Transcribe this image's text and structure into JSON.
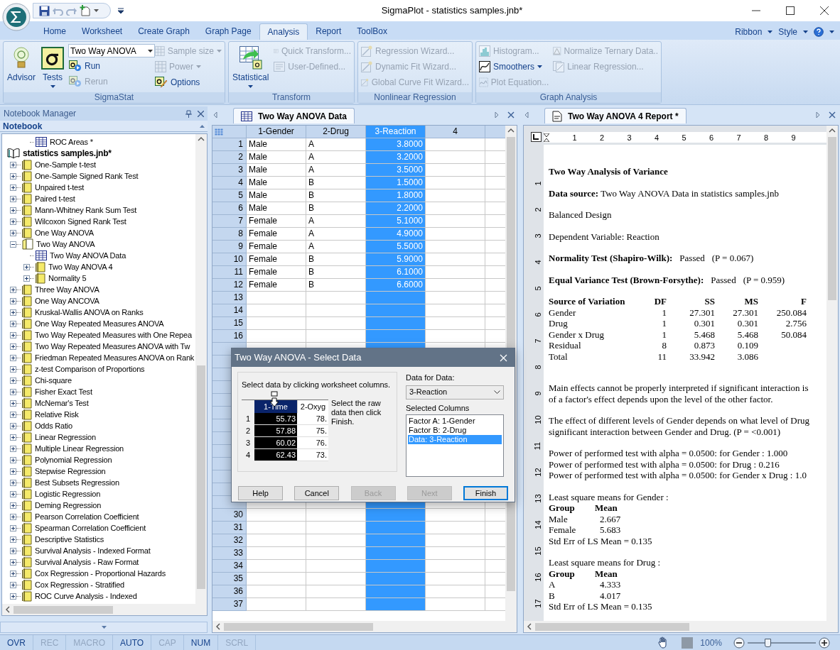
{
  "window": {
    "title": "SigmaPlot - statistics samples.jnb*"
  },
  "ribbon": {
    "tabs": [
      {
        "label": "Home",
        "selected": false
      },
      {
        "label": "Worksheet",
        "selected": false
      },
      {
        "label": "Create Graph",
        "selected": false
      },
      {
        "label": "Graph Page",
        "selected": false
      },
      {
        "label": "Analysis",
        "selected": true
      },
      {
        "label": "Report",
        "selected": false
      },
      {
        "label": "ToolBox",
        "selected": false
      }
    ],
    "right_menus": [
      "Ribbon",
      "Style"
    ],
    "groups": [
      {
        "label": "SigmaStat",
        "large": [
          {
            "label": "Advisor",
            "dropdown": false
          },
          {
            "label": "Tests",
            "dropdown": true
          }
        ],
        "combo": "Two Way ANOVA",
        "columns": [
          [
            {
              "label": "Run",
              "disabled": false,
              "dropdown": false
            },
            {
              "label": "Rerun",
              "disabled": true,
              "dropdown": false
            }
          ],
          [
            {
              "label": "Sample size",
              "disabled": true,
              "dropdown": true
            },
            {
              "label": "Power",
              "disabled": true,
              "dropdown": true
            },
            {
              "label": "Options",
              "disabled": false,
              "dropdown": false
            }
          ]
        ]
      },
      {
        "label": "Transform",
        "large": [
          {
            "label": "Statistical",
            "dropdown": true
          }
        ],
        "columns": [
          [
            {
              "label": "Quick Transform...",
              "disabled": true,
              "dropdown": false
            },
            {
              "label": "User-Defined...",
              "disabled": true,
              "dropdown": false
            }
          ]
        ]
      },
      {
        "label": "Nonlinear Regression",
        "columns": [
          [
            {
              "label": "Regression Wizard...",
              "disabled": true,
              "dropdown": false
            },
            {
              "label": "Dynamic Fit Wizard...",
              "disabled": true,
              "dropdown": false
            },
            {
              "label": "Global Curve Fit Wizard...",
              "disabled": true,
              "dropdown": false
            }
          ]
        ]
      },
      {
        "label": "Graph Analysis",
        "columns": [
          [
            {
              "label": "Histogram...",
              "disabled": true,
              "dropdown": false
            },
            {
              "label": "Smoothers",
              "disabled": false,
              "dropdown": true
            },
            {
              "label": "Plot Equation...",
              "disabled": true,
              "dropdown": false
            }
          ],
          [
            {
              "label": "Normalize Ternary Data..",
              "disabled": true,
              "dropdown": false
            },
            {
              "label": "Linear Regression...",
              "disabled": true,
              "dropdown": false
            }
          ]
        ]
      }
    ]
  },
  "notebook": {
    "title": "Notebook Manager",
    "section": "Notebook",
    "tree": [
      {
        "label": "ROC Areas *",
        "kind": "worksheet"
      },
      {
        "label": "statistics samples.jnb*",
        "kind": "notebook",
        "children": [
          {
            "label": "One-Sample t-test",
            "kind": "folder",
            "expanded": false
          },
          {
            "label": "One-Sample Signed Rank Test",
            "kind": "folder",
            "expanded": false
          },
          {
            "label": "Unpaired t-test",
            "kind": "folder",
            "expanded": false
          },
          {
            "label": "Paired t-test",
            "kind": "folder",
            "expanded": false
          },
          {
            "label": "Mann-Whitney Rank Sum Test",
            "kind": "folder",
            "expanded": false
          },
          {
            "label": "Wilcoxon Signed Rank Test",
            "kind": "folder",
            "expanded": false
          },
          {
            "label": "One Way ANOVA",
            "kind": "folder",
            "expanded": false
          },
          {
            "label": "Two Way ANOVA",
            "kind": "folder",
            "expanded": true,
            "children": [
              {
                "label": "Two Way ANOVA Data",
                "kind": "worksheet"
              },
              {
                "label": "Two Way ANOVA 4",
                "kind": "folder",
                "expanded": false
              },
              {
                "label": "Normality 5",
                "kind": "folder",
                "expanded": false
              }
            ]
          },
          {
            "label": "Three Way ANOVA",
            "kind": "folder",
            "expanded": false
          },
          {
            "label": "One Way ANCOVA",
            "kind": "folder",
            "expanded": false
          },
          {
            "label": "Kruskal-Wallis ANOVA on Ranks",
            "kind": "folder",
            "expanded": false
          },
          {
            "label": "One Way Repeated Measures ANOVA",
            "kind": "folder",
            "expanded": false
          },
          {
            "label": "Two Way Repeated Measures with One Repea",
            "kind": "folder",
            "expanded": false
          },
          {
            "label": "Two Way Repeated Measures ANOVA with Tw",
            "kind": "folder",
            "expanded": false
          },
          {
            "label": "Friedman Repeated Measures ANOVA on Rank",
            "kind": "folder",
            "expanded": false
          },
          {
            "label": "z-test Comparison of Proportions",
            "kind": "folder",
            "expanded": false
          },
          {
            "label": "Chi-square",
            "kind": "folder",
            "expanded": false
          },
          {
            "label": "Fisher Exact Test",
            "kind": "folder",
            "expanded": false
          },
          {
            "label": "McNemar's Test",
            "kind": "folder",
            "expanded": false
          },
          {
            "label": "Relative Risk",
            "kind": "folder",
            "expanded": false
          },
          {
            "label": "Odds Ratio",
            "kind": "folder",
            "expanded": false
          },
          {
            "label": "Linear Regression",
            "kind": "folder",
            "expanded": false
          },
          {
            "label": "Multiple Linear Regression",
            "kind": "folder",
            "expanded": false
          },
          {
            "label": "Polynomial Regression",
            "kind": "folder",
            "expanded": false
          },
          {
            "label": "Stepwise Regression",
            "kind": "folder",
            "expanded": false
          },
          {
            "label": "Best Subsets Regression",
            "kind": "folder",
            "expanded": false
          },
          {
            "label": "Logistic Regression",
            "kind": "folder",
            "expanded": false
          },
          {
            "label": "Deming Regression",
            "kind": "folder",
            "expanded": false
          },
          {
            "label": "Pearson Correlation Coefficient",
            "kind": "folder",
            "expanded": false
          },
          {
            "label": "Spearman Correlation Coefficient",
            "kind": "folder",
            "expanded": false
          },
          {
            "label": "Descriptive Statistics",
            "kind": "folder",
            "expanded": false
          },
          {
            "label": "Survival Analysis - Indexed Format",
            "kind": "folder",
            "expanded": false
          },
          {
            "label": "Survival Analysis - Raw Format",
            "kind": "folder",
            "expanded": false
          },
          {
            "label": "Cox Regression - Proportional Hazards",
            "kind": "folder",
            "expanded": false
          },
          {
            "label": "Cox Regression - Stratified",
            "kind": "folder",
            "expanded": false
          },
          {
            "label": "ROC Curve Analysis - Indexed",
            "kind": "folder",
            "expanded": false
          }
        ]
      }
    ]
  },
  "worksheet": {
    "title": "Two Way ANOVA Data",
    "columns": [
      {
        "label": "1-Gender",
        "kind": "text",
        "selected": false
      },
      {
        "label": "2-Drug",
        "kind": "text",
        "selected": false
      },
      {
        "label": "3-Reaction",
        "kind": "number",
        "selected": true
      },
      {
        "label": "4",
        "kind": "number",
        "selected": false
      }
    ],
    "rows_top": [
      {
        "number": "1",
        "cells": [
          "Male",
          "A",
          "3.8000"
        ]
      },
      {
        "number": "2",
        "cells": [
          "Male",
          "A",
          "3.2000"
        ]
      },
      {
        "number": "3",
        "cells": [
          "Male",
          "A",
          "3.5000"
        ]
      },
      {
        "number": "4",
        "cells": [
          "Male",
          "B",
          "1.5000"
        ]
      },
      {
        "number": "5",
        "cells": [
          "Male",
          "B",
          "1.8000"
        ]
      },
      {
        "number": "6",
        "cells": [
          "Male",
          "B",
          "2.2000"
        ]
      },
      {
        "number": "7",
        "cells": [
          "Female",
          "A",
          "5.1000"
        ]
      },
      {
        "number": "8",
        "cells": [
          "Female",
          "A",
          "4.9000"
        ]
      },
      {
        "number": "9",
        "cells": [
          "Female",
          "A",
          "5.5000"
        ]
      },
      {
        "number": "10",
        "cells": [
          "Female",
          "B",
          "5.9000"
        ]
      },
      {
        "number": "11",
        "cells": [
          "Female",
          "B",
          "6.1000"
        ]
      },
      {
        "number": "12",
        "cells": [
          "Female",
          "B",
          "6.6000"
        ]
      },
      {
        "number": "13"
      },
      {
        "number": "14"
      },
      {
        "number": "15"
      },
      {
        "number": "16"
      }
    ],
    "rows_bottom": [
      {
        "number": "30"
      },
      {
        "number": "31"
      },
      {
        "number": "32"
      },
      {
        "number": "33"
      },
      {
        "number": "34"
      },
      {
        "number": "35"
      },
      {
        "number": "36"
      },
      {
        "number": "37"
      }
    ]
  },
  "dialog": {
    "title": "Two Way ANOVA - Select Data",
    "instruction": "Select data by clicking worksheet columns.",
    "mini_grid": {
      "columns": [
        {
          "label": "1-Time",
          "selected": true
        },
        {
          "label": "2-Oxyg",
          "selected": false
        }
      ],
      "rows": [
        {
          "number": "1",
          "cells": [
            "55.73",
            "78."
          ]
        },
        {
          "number": "2",
          "cells": [
            "57.88",
            "75."
          ]
        },
        {
          "number": "3",
          "cells": [
            "60.02",
            "76."
          ]
        },
        {
          "number": "4",
          "cells": [
            "62.43",
            "73."
          ]
        }
      ]
    },
    "hint": "Select the raw data then click Finish.",
    "data_for_label": "Data for Data:",
    "data_for_value": "3-Reaction",
    "selected_columns_label": "Selected Columns",
    "selected_columns": [
      {
        "label": "Factor A: 1-Gender",
        "selected": false
      },
      {
        "label": "Factor B: 2-Drug",
        "selected": false
      },
      {
        "label": "Data: 3-Reaction",
        "selected": true
      }
    ],
    "buttons": [
      {
        "label": "Help",
        "disabled": false,
        "default": false
      },
      {
        "label": "Cancel",
        "disabled": false,
        "default": false
      },
      {
        "label": "Back",
        "disabled": true,
        "default": false
      },
      {
        "label": "Next",
        "disabled": true,
        "default": false
      },
      {
        "label": "Finish",
        "disabled": false,
        "default": true
      }
    ]
  },
  "report": {
    "title": "Two Way ANOVA 4 Report *",
    "ruler": [
      "1",
      "2",
      "3",
      "4",
      "5",
      "6",
      "7",
      "8",
      "9"
    ],
    "vertical_ruler": [
      "1",
      "2",
      "3",
      "4",
      "5",
      "6",
      "7",
      "8",
      "9",
      "10",
      "11",
      "12",
      "13",
      "14",
      "15",
      "16",
      "17"
    ],
    "blocks": [
      {
        "kind": "heading",
        "text": "Two Way Analysis of Variance"
      },
      {
        "kind": "paragraph",
        "text": "**Data source:** Two Way ANOVA Data in statistics samples.jnb"
      },
      {
        "kind": "paragraph",
        "text": "Balanced Design"
      },
      {
        "kind": "paragraph",
        "text": "Dependent Variable: Reaction"
      },
      {
        "kind": "test",
        "label": "Normality Test (Shapiro-Wilk):",
        "result": "Passed",
        "p": "(P = 0.067)"
      },
      {
        "kind": "test",
        "label": "Equal Variance Test (Brown-Forsythe):",
        "result": "Passed",
        "p": "(P = 0.959)"
      },
      {
        "kind": "table",
        "columns": [
          "Source of Variation",
          "DF",
          "SS",
          "MS",
          "F"
        ],
        "rows": [
          [
            "Gender",
            "1",
            "27.301",
            "27.301",
            "250.084"
          ],
          [
            "Drug",
            "1",
            "0.301",
            "0.301",
            "2.756"
          ],
          [
            "Gender x Drug",
            "1",
            "5.468",
            "5.468",
            "50.084"
          ],
          [
            "Residual",
            "8",
            "0.873",
            "0.109"
          ],
          [
            "Total",
            "11",
            "33.942",
            "3.086"
          ]
        ]
      },
      {
        "kind": "lines",
        "lines": [
          "Main effects cannot be properly interpreted if significant interaction is",
          "of a factor's effect depends upon the level of the other factor."
        ]
      },
      {
        "kind": "lines",
        "lines": [
          "The effect of different levels of Gender depends on what level of Drug",
          "significant interaction between Gender and Drug.  (P = <0.001)"
        ]
      },
      {
        "kind": "lines",
        "lines": [
          "Power of performed test with alpha = 0.0500:  for Gender : 1.000",
          "Power of performed test with alpha = 0.0500:  for Drug : 0.216",
          "Power of performed test with alpha = 0.0500:  for Gender x Drug : 1.0"
        ]
      },
      {
        "kind": "means",
        "title": "Least square means for Gender :",
        "columns": [
          "Group",
          "Mean"
        ],
        "rows": [
          [
            "Male",
            "2.667"
          ],
          [
            "Female",
            "5.683"
          ]
        ],
        "footer": "Std Err of LS Mean = 0.135"
      },
      {
        "kind": "means",
        "title": "Least square means for Drug :",
        "columns": [
          "Group",
          "Mean"
        ],
        "rows": [
          [
            "A",
            "4.333"
          ],
          [
            "B",
            "4.017"
          ]
        ],
        "footer": "Std Err of LS Mean = 0.135"
      }
    ]
  },
  "status_bar": {
    "indicators": [
      {
        "label": "OVR",
        "active": true
      },
      {
        "label": "REC",
        "active": false
      },
      {
        "label": "MACRO",
        "active": false
      },
      {
        "label": "AUTO",
        "active": true
      },
      {
        "label": "CAP",
        "active": false
      },
      {
        "label": "NUM",
        "active": true
      },
      {
        "label": "SCRL",
        "active": false
      }
    ],
    "zoom": {
      "value": "100%",
      "level": 0.28
    }
  }
}
